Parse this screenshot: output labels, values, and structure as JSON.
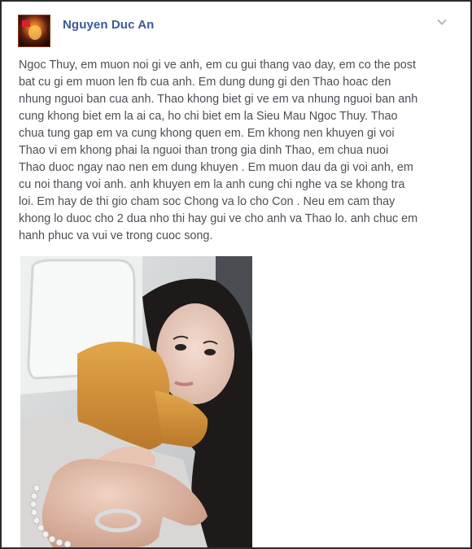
{
  "post": {
    "author": "Nguyen Duc An",
    "text": "Ngoc Thuy, em muon noi gi ve anh, em cu gui thang vao day, em co the post\nbat cu gi em muon len fb cua anh. Em dung dung gi den Thao hoac den\nnhung nguoi ban cua anh. Thao khong biet gi ve em va nhung nguoi ban anh\ncung khong biet em la ai ca, ho chi biet em la Sieu Mau Ngoc Thuy. Thao\nchua tung gap em va cung khong quen em. Em khong nen khuyen gi voi\nThao vi em khong phai la nguoi than trong gia dinh Thao, em chua nuoi\nThao duoc ngay nao nen em dung khuyen . Em muon dau da gi voi anh, em\ncu noi thang voi anh. anh khuyen em la anh cung chi nghe va se khong tra\nloi. Em hay de thi gio cham soc Chong va lo cho Con . Neu em cam thay\nkhong lo duoc cho 2 dua nho thi hay gui ve cho anh va Thao lo. anh chuc em\nhanh phuc va vui ve trong cuoc song.",
    "menu_icon": "chevron-down-icon",
    "photo_subject": "selfie-photo"
  },
  "colors": {
    "author_link": "#3b5998",
    "body_text": "#4b4f56",
    "frame_border": "#2b2b2b"
  }
}
